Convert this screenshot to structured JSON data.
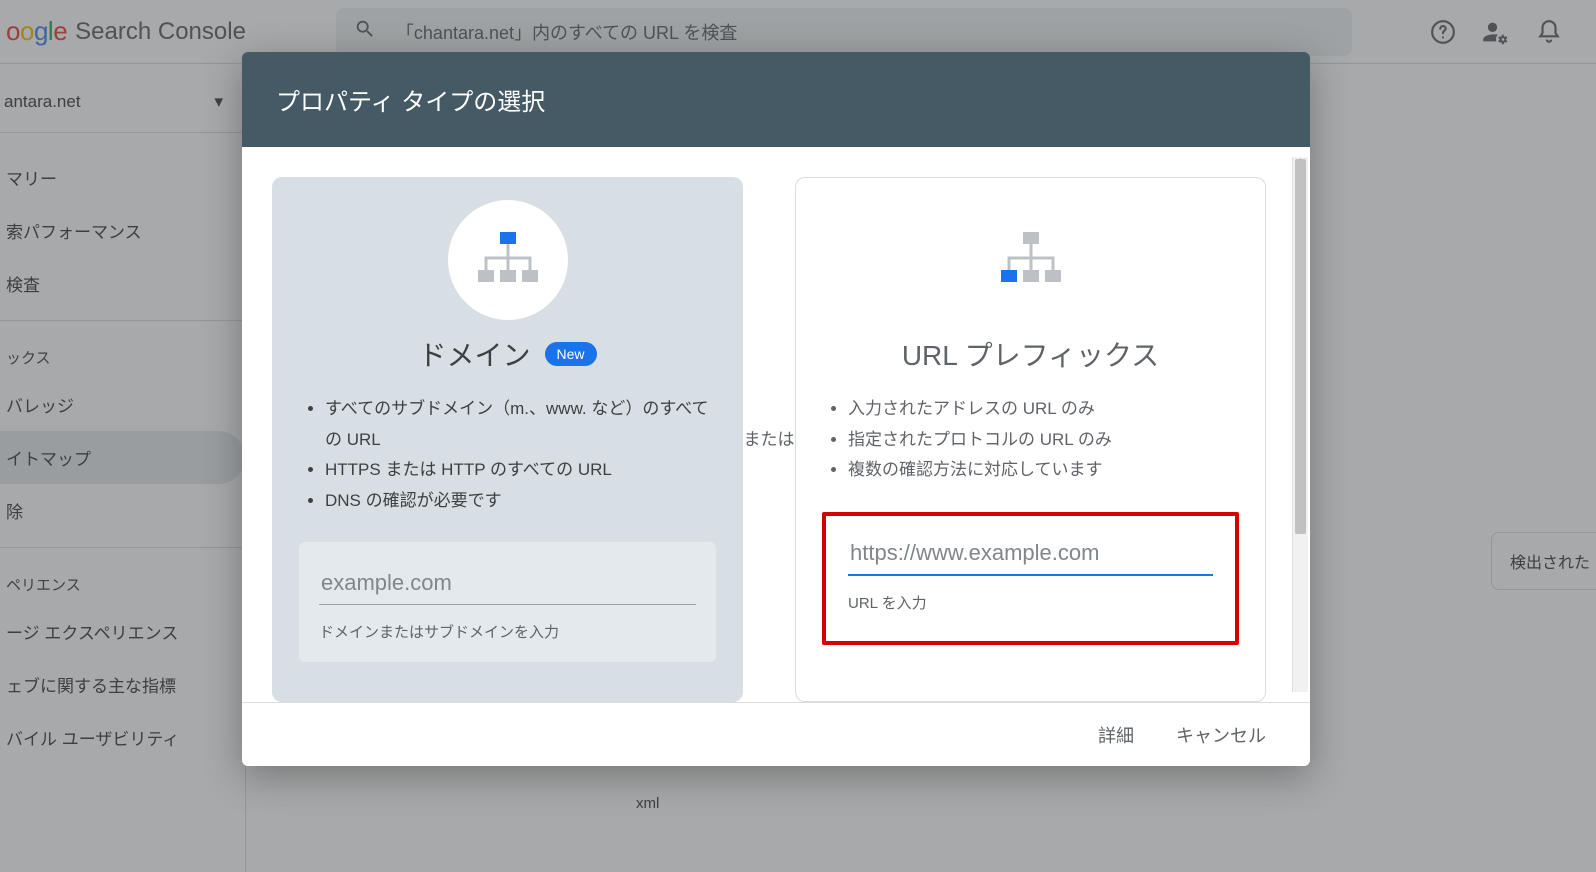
{
  "header": {
    "product": "Search Console",
    "search_placeholder": "「chantara.net」内のすべての URL を検査",
    "logo_chars": [
      "o",
      "o",
      "g",
      "l",
      "e"
    ]
  },
  "sidebar": {
    "property": "antara.net",
    "items": [
      "マリー",
      "索パフォーマンス",
      "検査"
    ],
    "index_heading": "ックス",
    "index_items": [
      "バレッジ",
      "イトマップ",
      "除"
    ],
    "exp_heading": "ペリエンス",
    "exp_items": [
      "ージ エクスペリエンス",
      "ェブに関する主な指標",
      "バイル ユーザビリティ"
    ]
  },
  "main": {
    "discovered_label": "検出された",
    "xml_label": "xml"
  },
  "dialog": {
    "title": "プロパティ タイプの選択",
    "or": "または",
    "domain_card": {
      "title": "ドメイン",
      "badge": "New",
      "bullets": [
        "すべてのサブドメイン（m.、www. など）のすべての URL",
        "HTTPS または HTTP のすべての URL",
        "DNS の確認が必要です"
      ],
      "input_placeholder": "example.com",
      "helper": "ドメインまたはサブドメインを入力"
    },
    "url_card": {
      "title": "URL プレフィックス",
      "bullets": [
        "入力されたアドレスの URL のみ",
        "指定されたプロトコルの URL のみ",
        "複数の確認方法に対応しています"
      ],
      "input_placeholder": "https://www.example.com",
      "helper": "URL を入力"
    },
    "actions": {
      "learn_more": "詳細",
      "cancel": "キャンセル"
    }
  }
}
